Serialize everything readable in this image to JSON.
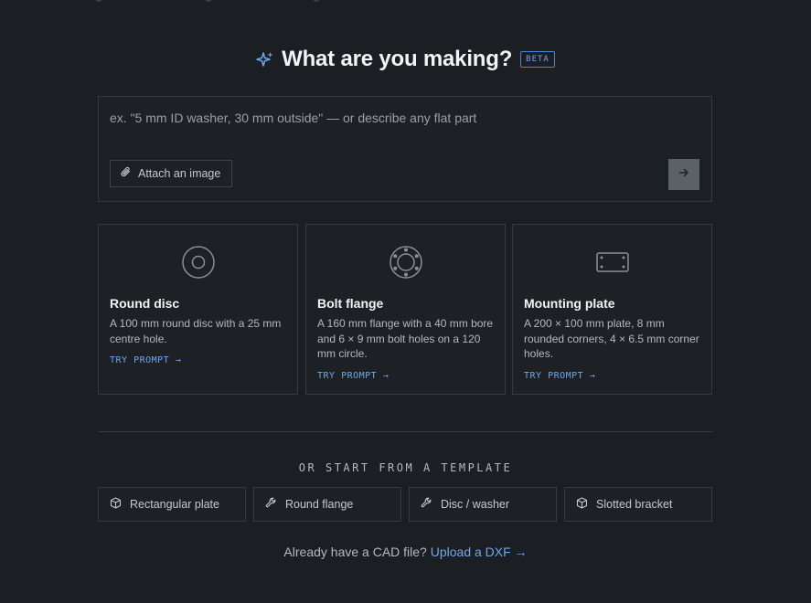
{
  "header": {
    "title": "What are you making?",
    "badge": "BETA",
    "icon": "sparkle-icon"
  },
  "prompt": {
    "placeholder": "ex. \"5 mm ID washer, 30 mm outside\" — or describe any flat part",
    "attach_label": "Attach an image",
    "attach_icon": "paperclip-icon",
    "send_icon": "arrow-right-icon"
  },
  "cards": [
    {
      "icon": "disc-icon",
      "title": "Round disc",
      "description": "A 100 mm round disc with a 25 mm centre hole.",
      "cta": "TRY PROMPT →"
    },
    {
      "icon": "flange-icon",
      "title": "Bolt flange",
      "description": "A 160 mm flange with a 40 mm bore and 6 × 9 mm bolt holes on a 120 mm circle.",
      "cta": "TRY PROMPT →"
    },
    {
      "icon": "plate-icon",
      "title": "Mounting plate",
      "description": "A 200 × 100 mm plate, 8 mm rounded corners, 4 × 6.5 mm corner holes.",
      "cta": "TRY PROMPT →"
    }
  ],
  "templates": {
    "heading": "OR START FROM A TEMPLATE",
    "items": [
      {
        "icon": "cube-icon",
        "label": "Rectangular plate"
      },
      {
        "icon": "wrench-icon",
        "label": "Round flange"
      },
      {
        "icon": "wrench-icon",
        "label": "Disc / washer"
      },
      {
        "icon": "cube-icon",
        "label": "Slotted bracket"
      }
    ]
  },
  "footer": {
    "text": "Already have a CAD file?",
    "link": "Upload a DXF →"
  },
  "colors": {
    "background": "#1b1e22",
    "accent": "#6fa8e8",
    "border": "#353a40"
  }
}
